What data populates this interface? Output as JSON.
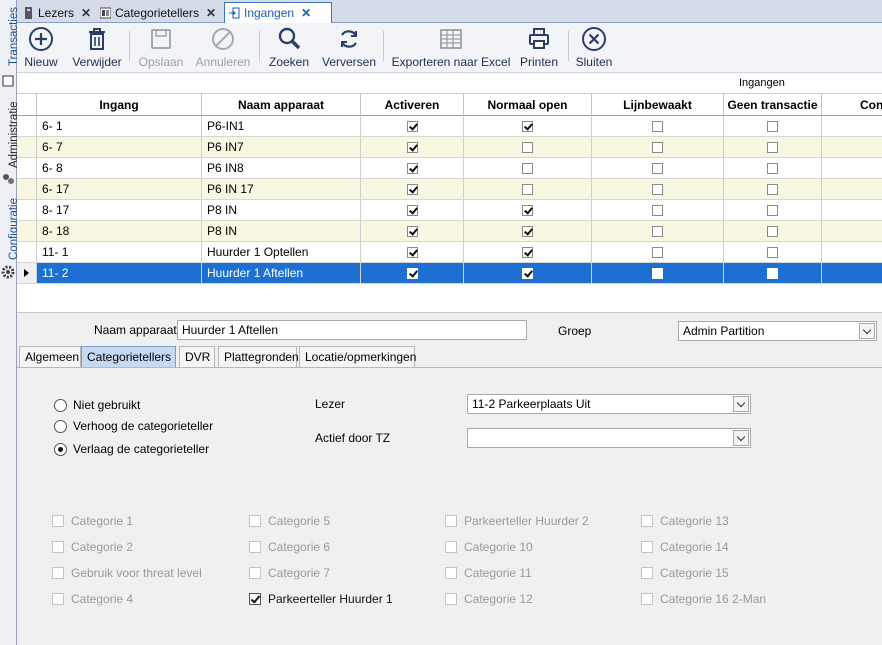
{
  "side_tabs": {
    "transacties": "Transacties",
    "administratie": "Administratie",
    "configuratie": "Configuratie"
  },
  "tabs": [
    {
      "label": "Lezers"
    },
    {
      "label": "Categorietellers"
    },
    {
      "label": "Ingangen"
    }
  ],
  "toolbar": {
    "nieuw": "Nieuw",
    "verwijder": "Verwijder",
    "opslaan": "Opslaan",
    "annuleren": "Annuleren",
    "zoeken": "Zoeken",
    "verversen": "Verversen",
    "exporteren": "Exporteren naar Excel",
    "printen": "Printen",
    "sluiten": "Sluiten"
  },
  "grid": {
    "group_header": "Ingangen",
    "columns": [
      "Ingang",
      "Naam apparaat",
      "Activeren",
      "Normaal open",
      "Lijnbewaakt",
      "Geen transactie",
      "Con"
    ],
    "rows": [
      {
        "ingang": "6- 1",
        "naam": "P6-IN1",
        "activeren": true,
        "normaal_open": true,
        "lijnbewaakt": false,
        "geen_transactie": false
      },
      {
        "ingang": "6- 7",
        "naam": "P6 IN7",
        "activeren": true,
        "normaal_open": false,
        "lijnbewaakt": false,
        "geen_transactie": false
      },
      {
        "ingang": "6- 8",
        "naam": "P6 IN8",
        "activeren": true,
        "normaal_open": false,
        "lijnbewaakt": false,
        "geen_transactie": false
      },
      {
        "ingang": "6- 17",
        "naam": "P6 IN 17",
        "activeren": true,
        "normaal_open": false,
        "lijnbewaakt": false,
        "geen_transactie": false
      },
      {
        "ingang": "8- 17",
        "naam": "P8 IN",
        "activeren": true,
        "normaal_open": true,
        "lijnbewaakt": false,
        "geen_transactie": false
      },
      {
        "ingang": "8- 18",
        "naam": "P8 IN",
        "activeren": true,
        "normaal_open": true,
        "lijnbewaakt": false,
        "geen_transactie": false
      },
      {
        "ingang": "11- 1",
        "naam": "Huurder 1 Optellen",
        "activeren": true,
        "normaal_open": true,
        "lijnbewaakt": false,
        "geen_transactie": false
      },
      {
        "ingang": "11- 2",
        "naam": "Huurder 1 Aftellen",
        "activeren": true,
        "normaal_open": true,
        "lijnbewaakt": false,
        "geen_transactie": false,
        "selected": true
      }
    ]
  },
  "detail": {
    "naam_label": "Naam apparaat",
    "naam_value": "Huurder 1 Aftellen",
    "groep_label": "Groep",
    "groep_value": "Admin Partition",
    "subtabs": [
      "Algemeen",
      "Categorietellers",
      "DVR",
      "Plattegronden",
      "Locatie/opmerkingen"
    ],
    "active_subtab": "Categorietellers",
    "radios": [
      {
        "label": "Niet gebruikt",
        "checked": false
      },
      {
        "label": "Verhoog de categorieteller",
        "checked": false
      },
      {
        "label": "Verlaag de categorieteller",
        "checked": true
      }
    ],
    "lezer_label": "Lezer",
    "lezer_value": "11-2 Parkeerplaats Uit",
    "actief_label": "Actief door TZ",
    "actief_value": "",
    "categories": [
      {
        "label": "Categorie 1",
        "checked": false,
        "enabled": false
      },
      {
        "label": "Categorie 2",
        "checked": false,
        "enabled": false
      },
      {
        "label": "Gebruik voor threat level",
        "checked": false,
        "enabled": false
      },
      {
        "label": "Categorie 4",
        "checked": false,
        "enabled": false
      },
      {
        "label": "Categorie 5",
        "checked": false,
        "enabled": false
      },
      {
        "label": "Categorie 6",
        "checked": false,
        "enabled": false
      },
      {
        "label": "Categorie 7",
        "checked": false,
        "enabled": false
      },
      {
        "label": "Parkeerteller Huurder 1",
        "checked": true,
        "enabled": true
      },
      {
        "label": "Parkeerteller Huurder 2",
        "checked": false,
        "enabled": false
      },
      {
        "label": "Categorie 10",
        "checked": false,
        "enabled": false
      },
      {
        "label": "Categorie 11",
        "checked": false,
        "enabled": false
      },
      {
        "label": "Categorie 12",
        "checked": false,
        "enabled": false
      },
      {
        "label": "Categorie 13",
        "checked": false,
        "enabled": false
      },
      {
        "label": "Categorie 14",
        "checked": false,
        "enabled": false
      },
      {
        "label": "Categorie 15",
        "checked": false,
        "enabled": false
      },
      {
        "label": "Categorie 16 2-Man",
        "checked": false,
        "enabled": false
      }
    ]
  }
}
